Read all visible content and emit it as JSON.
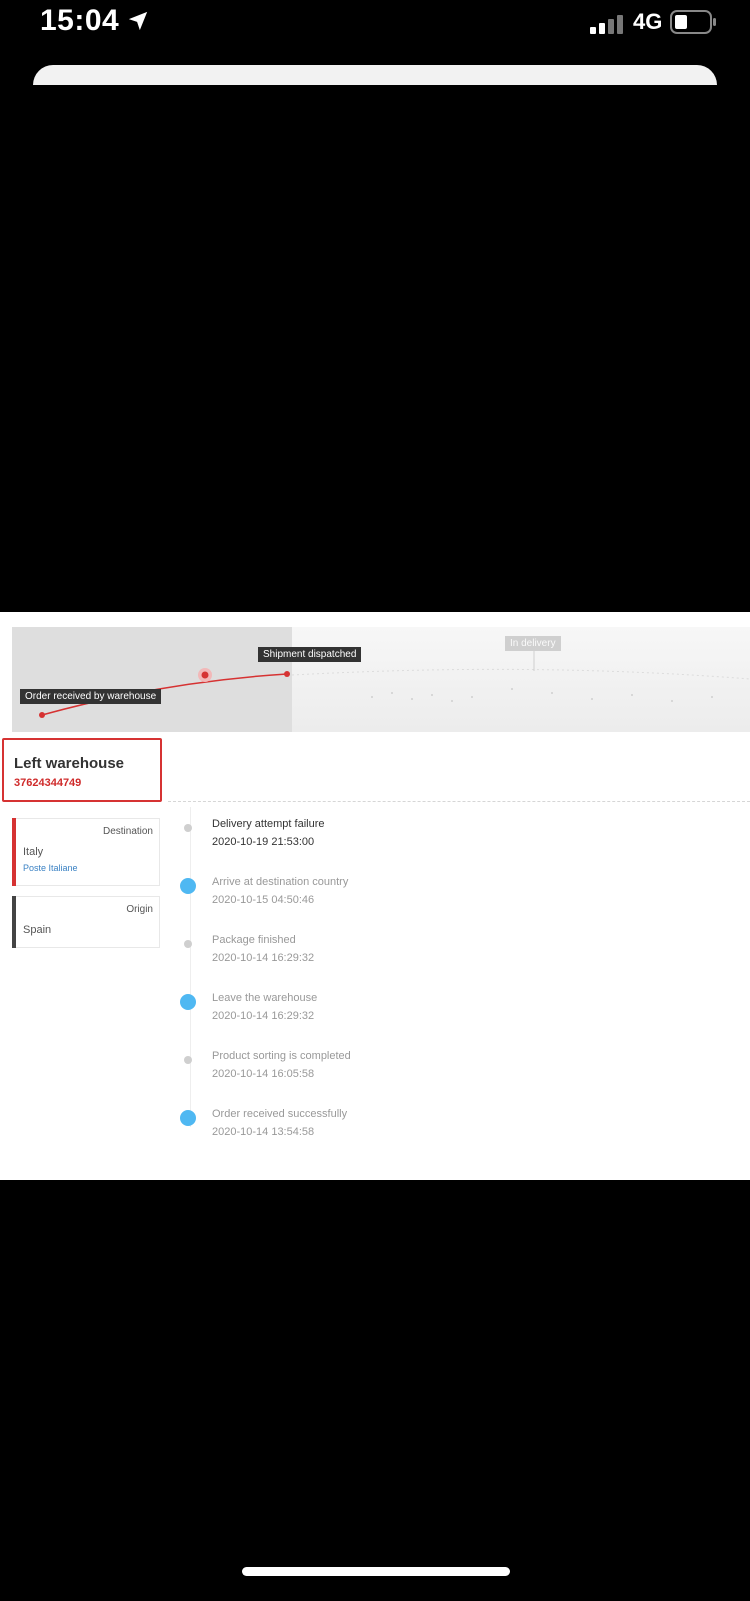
{
  "status_bar": {
    "time": "15:04",
    "network": "4G",
    "icons": [
      "location-arrow-icon",
      "signal-icon",
      "battery-icon"
    ]
  },
  "map": {
    "labels": {
      "order_received": "Order received by warehouse",
      "dispatched": "Shipment dispatched",
      "in_delivery": "In delivery"
    }
  },
  "shipment": {
    "status": "Left warehouse",
    "tracking_number": "37624344749"
  },
  "destination": {
    "label": "Destination",
    "country": "Italy",
    "carrier": "Poste Italiane",
    "color": "#d63232"
  },
  "origin": {
    "label": "Origin",
    "country": "Spain",
    "color": "#444444"
  },
  "events": [
    {
      "event": "Delivery attempt failure",
      "time": "2020-10-19 21:53:00",
      "marker": "small",
      "active": true
    },
    {
      "event": "Arrive at destination country",
      "time": "2020-10-15 04:50:46",
      "marker": "big",
      "active": false
    },
    {
      "event": "Package finished",
      "time": "2020-10-14 16:29:32",
      "marker": "small",
      "active": false
    },
    {
      "event": "Leave the warehouse",
      "time": "2020-10-14 16:29:32",
      "marker": "big",
      "active": false
    },
    {
      "event": "Product sorting is completed",
      "time": "2020-10-14 16:05:58",
      "marker": "small",
      "active": false
    },
    {
      "event": "Order received successfully",
      "time": "2020-10-14 13:54:58",
      "marker": "big",
      "active": false
    }
  ],
  "colors": {
    "accent_red": "#d63232",
    "timeline_blue": "#4fb8f2"
  }
}
